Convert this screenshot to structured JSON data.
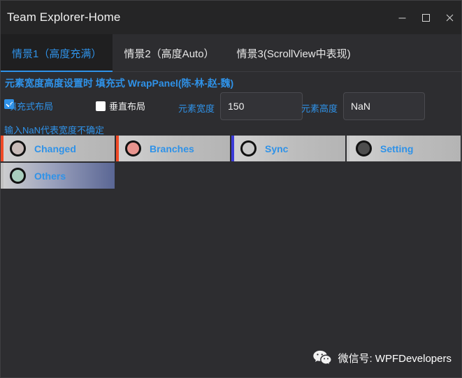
{
  "window": {
    "title": "Team Explorer-Home",
    "minimize_icon": "minimize-icon",
    "maximize_icon": "maximize-icon",
    "close_icon": "close-icon",
    "background": "#2d2d30",
    "titlebar_background": "#252526"
  },
  "tabs": {
    "active_index": 0,
    "accent": "#2f92e8",
    "items": [
      {
        "label": "情景1（高度充满）"
      },
      {
        "label": "情景2（高度Auto）"
      },
      {
        "label": "情景3(ScrollView中表现)"
      }
    ]
  },
  "main": {
    "section_title": "元素宽度高度设置时 填充式 WrapPanel(陈-林-赵-魏)",
    "hint": "输入NaN代表宽度不确定",
    "checkboxes": [
      {
        "label": "填充式布局",
        "checked": true,
        "check_icon": "check-icon"
      },
      {
        "label": "垂直布局",
        "checked": false,
        "check_icon": "check-icon"
      }
    ],
    "fields": [
      {
        "label": "元素宽度",
        "value": "150",
        "placeholder": ""
      },
      {
        "label": "元素高度",
        "value": "NaN",
        "placeholder": ""
      }
    ],
    "cards": [
      {
        "label": "Changed",
        "accent_color": "#f04a26",
        "circle_color": "#c8bbb8",
        "hovered": false
      },
      {
        "label": "Branches",
        "accent_color": "#f04a26",
        "circle_color": "#e8948e",
        "hovered": false
      },
      {
        "label": "Sync",
        "accent_color": "#3a3ad8",
        "circle_color": "#c9c9c9",
        "hovered": false
      },
      {
        "label": "Setting",
        "accent_color": "#c8c8c8",
        "circle_color": "#4d4d4d",
        "hovered": false
      },
      {
        "label": "Others",
        "accent_color": "#c0c0c0",
        "circle_color": "#a8cdbd",
        "hovered": true
      }
    ]
  },
  "footer": {
    "icon": "wechat-icon",
    "text": "微信号: WPFDevelopers"
  }
}
